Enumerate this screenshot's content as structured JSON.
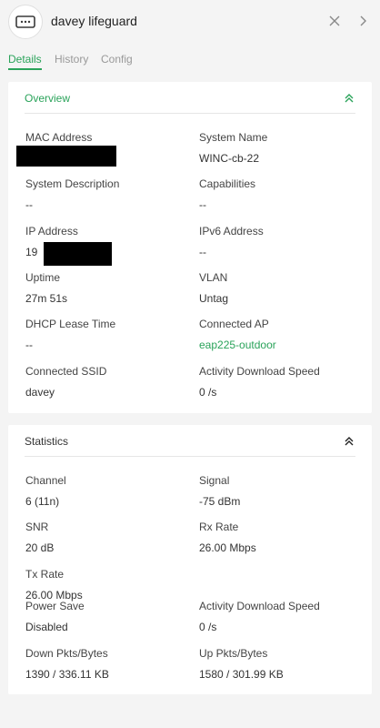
{
  "header": {
    "device_name": "davey lifeguard",
    "icons": {
      "device": "ethernet-device-icon",
      "close": "close-icon",
      "next": "chevron-right-icon"
    }
  },
  "tabs": [
    {
      "label": "Details",
      "active": true
    },
    {
      "label": "History",
      "active": false
    },
    {
      "label": "Config",
      "active": false
    }
  ],
  "overview": {
    "title": "Overview",
    "fields": {
      "mac_address": {
        "label": "MAC Address",
        "value": ""
      },
      "system_name": {
        "label": "System Name",
        "value": "WINC-cb-22"
      },
      "system_description": {
        "label": "System Description",
        "value": "--"
      },
      "capabilities": {
        "label": "Capabilities",
        "value": "--"
      },
      "ip_address": {
        "label": "IP Address",
        "value": "19"
      },
      "ipv6_address": {
        "label": "IPv6 Address",
        "value": "--"
      },
      "uptime": {
        "label": "Uptime",
        "value": "27m 51s"
      },
      "vlan": {
        "label": "VLAN",
        "value": "Untag"
      },
      "dhcp_lease_time": {
        "label": "DHCP Lease Time",
        "value": "--"
      },
      "connected_ap": {
        "label": "Connected AP",
        "value": "eap225-outdoor"
      },
      "connected_ssid": {
        "label": "Connected SSID",
        "value": "davey"
      },
      "activity_download_speed": {
        "label": "Activity Download Speed",
        "value": "0 /s"
      }
    }
  },
  "statistics": {
    "title": "Statistics",
    "fields": {
      "channel": {
        "label": "Channel",
        "value": "6 (11n)"
      },
      "signal": {
        "label": "Signal",
        "value": "-75 dBm"
      },
      "snr": {
        "label": "SNR",
        "value": "20 dB"
      },
      "rx_rate": {
        "label": "Rx Rate",
        "value": "26.00 Mbps"
      },
      "tx_rate": {
        "label": "Tx Rate",
        "value": "26.00 Mbps"
      },
      "power_save": {
        "label": "Power Save",
        "value": "Disabled"
      },
      "activity_download_speed": {
        "label": "Activity Download Speed",
        "value": "0 /s"
      },
      "down_pkts_bytes": {
        "label": "Down Pkts/Bytes",
        "value": "1390 / 336.11 KB"
      },
      "up_pkts_bytes": {
        "label": "Up Pkts/Bytes",
        "value": "1580 / 301.99 KB"
      }
    }
  },
  "colors": {
    "accent": "#2aa35a",
    "background": "#f4f4f4",
    "card": "#ffffff"
  }
}
